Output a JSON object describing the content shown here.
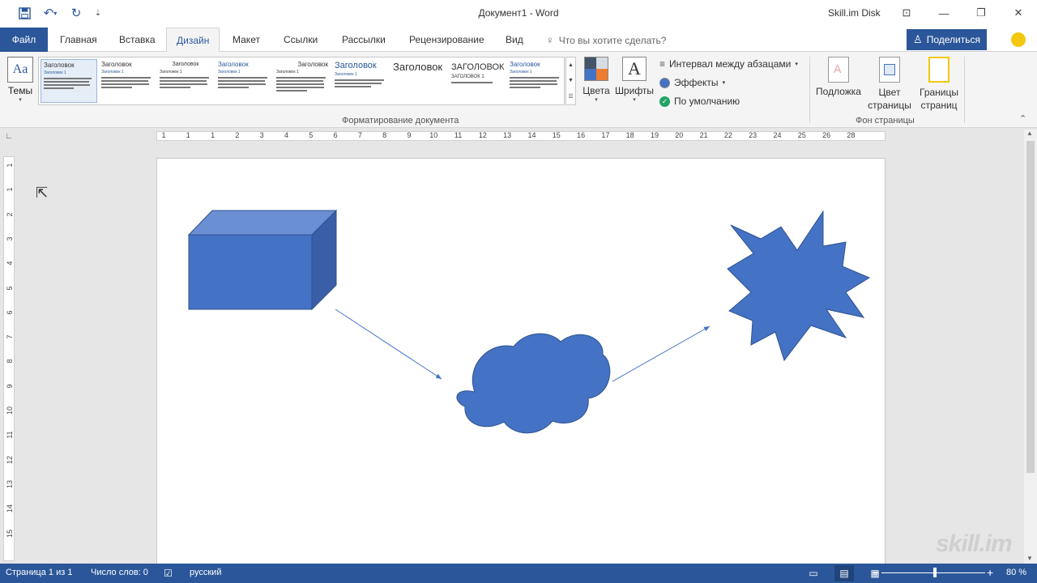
{
  "window": {
    "title": "Документ1  -  Word",
    "account": "Skill.im Disk"
  },
  "ribbon_tabs": {
    "file": "Файл",
    "items": [
      "Главная",
      "Вставка",
      "Дизайн",
      "Макет",
      "Ссылки",
      "Рассылки",
      "Рецензирование",
      "Вид"
    ],
    "active": "Дизайн",
    "tell_me_placeholder": "Что вы хотите сделать?",
    "share": "Поделиться"
  },
  "design": {
    "themes_label": "Темы",
    "gallery": [
      {
        "heading": "Заголовок",
        "sub": "Заголовок 1"
      },
      {
        "heading": "Заголовок",
        "sub": "Заголовок 1"
      },
      {
        "heading": "Заголовок",
        "sub": "Заголовок 1"
      },
      {
        "heading": "Заголовок",
        "sub": "Заголовок 1"
      },
      {
        "heading": "Заголовок",
        "sub": "Заголовок 1"
      },
      {
        "heading": "Заголовок",
        "sub": "Заголовок 1"
      },
      {
        "heading": "Заголовок",
        "sub": ""
      },
      {
        "heading": "ЗАГОЛОВОК",
        "sub": "ЗАГОЛОВОК 1"
      },
      {
        "heading": "Заголовок",
        "sub": "Заголовок 1"
      }
    ],
    "colors_label": "Цвета",
    "fonts_label": "Шрифты",
    "paragraph_spacing": "Интервал между абзацами",
    "effects": "Эффекты",
    "set_default": "По умолчанию",
    "group_document_formatting": "Форматирование документа",
    "watermark_label": "Подложка",
    "page_color_label": "Цвет страницы",
    "page_borders_label": "Границы страниц",
    "group_page_background": "Фон страницы",
    "theme_colors": [
      "#44546a",
      "#d6dce4",
      "#4472c4",
      "#ed7d31"
    ]
  },
  "ruler": {
    "h_numbers": [
      "1",
      "1",
      "1",
      "2",
      "3",
      "4",
      "5",
      "6",
      "7",
      "8",
      "9",
      "10",
      "11",
      "12",
      "13",
      "14",
      "15",
      "16",
      "17",
      "18",
      "19",
      "20",
      "21",
      "22",
      "23",
      "24",
      "25",
      "26",
      "28"
    ],
    "v_numbers": [
      "1",
      "1",
      "2",
      "3",
      "4",
      "5",
      "6",
      "7",
      "8",
      "9",
      "10",
      "11",
      "12",
      "13",
      "14",
      "15"
    ]
  },
  "document": {
    "shapes": [
      "cube",
      "cloud",
      "explosion"
    ],
    "shape_color": "#4472c4"
  },
  "status": {
    "page": "Страница 1 из 1",
    "words": "Число слов: 0",
    "language": "русский",
    "zoom": "80 %",
    "zoom_value": 80
  },
  "watermark_text": "skill.im"
}
